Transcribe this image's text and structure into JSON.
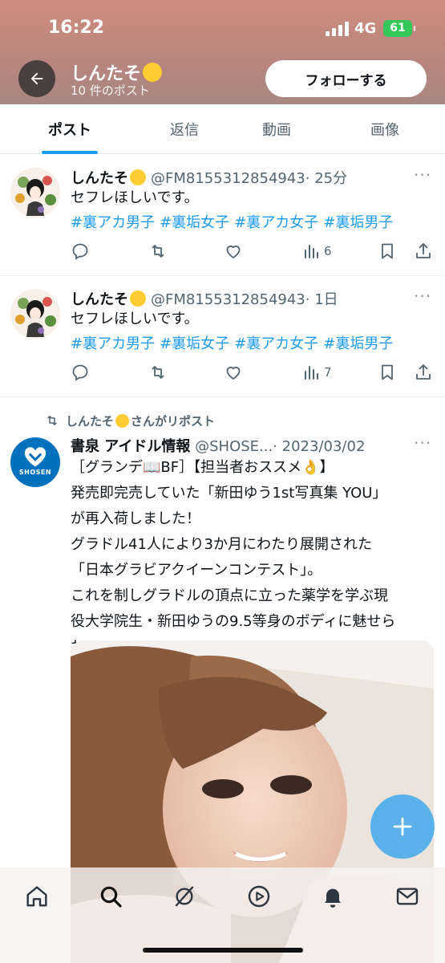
{
  "status_bar": {
    "time": "16:22",
    "network": "4G",
    "battery": "61"
  },
  "header": {
    "profile_name": "しんたそ",
    "post_count": "10 件のポスト",
    "follow_label": "フォローする"
  },
  "tabs": [
    {
      "label": "ポスト",
      "active": true
    },
    {
      "label": "返信",
      "active": false
    },
    {
      "label": "動画",
      "active": false
    },
    {
      "label": "画像",
      "active": false
    }
  ],
  "tweets": [
    {
      "name": "しんたそ",
      "handle": "@FM8155312854943",
      "time": "· 25分",
      "text": "セフレほしいです。",
      "tags": [
        "#裏アカ男子",
        "#裏垢女子",
        "#裏アカ女子",
        "#裏垢男子"
      ],
      "views": "6"
    },
    {
      "name": "しんたそ",
      "handle": "@FM8155312854943",
      "time": "· 1日",
      "text": "セフレほしいです。",
      "tags": [
        "#裏アカ男子",
        "#裏垢女子",
        "#裏アカ女子",
        "#裏垢男子"
      ],
      "views": "7"
    }
  ],
  "repost": {
    "by_prefix": "しんたそ",
    "by_suffix": "さんがリポスト",
    "name": "書泉 アイドル情報",
    "handle": "@SHOSE...",
    "time": "· 2023/03/02",
    "avatar_label": "SHOSEN",
    "lines": [
      "［グランデ📖BF］【担当者おススメ👌】",
      "発売即完売していた「新田ゆう1st写真集 YOU」",
      "が再入荷しました！",
      "グラドル41人により3か月にわたり展開された",
      "「日本グラビアクイーンコンテスト」。",
      "これを制しグラドルの頂点に立った薬学を学ぶ現",
      "役大学院生・新田ゆうの9.5等身のボディに魅せら",
      "れろ！"
    ]
  },
  "nav": [
    "home-icon",
    "search-icon",
    "grok-icon",
    "video-icon",
    "notifications-icon",
    "messages-icon"
  ]
}
